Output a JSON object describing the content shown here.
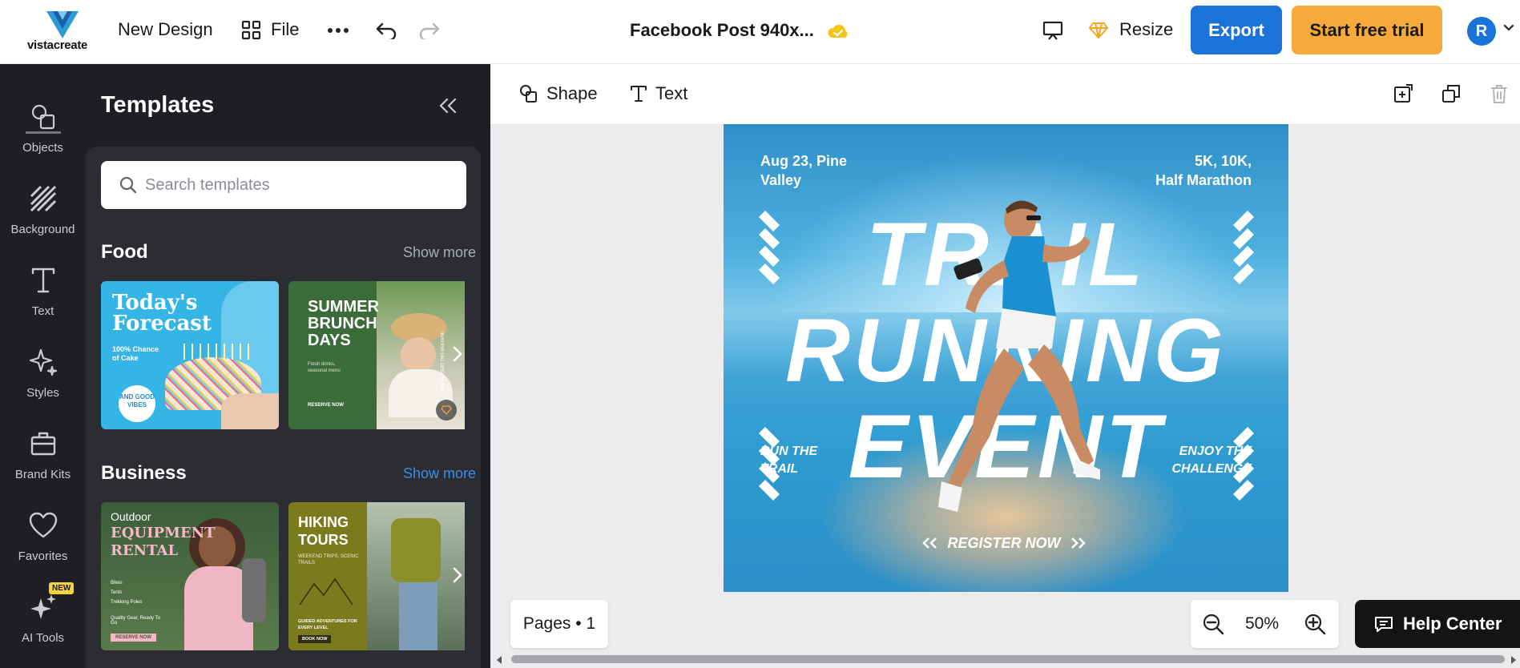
{
  "topbar": {
    "brand": "vistacreate",
    "new_design": "New Design",
    "file": "File",
    "doc_title": "Facebook Post 940x...",
    "resize": "Resize",
    "export": "Export",
    "start_trial": "Start free trial",
    "avatar_initial": "R"
  },
  "rail": {
    "items": [
      {
        "label": "Objects",
        "icon": "objects-icon"
      },
      {
        "label": "Background",
        "icon": "background-icon"
      },
      {
        "label": "Text",
        "icon": "text-icon"
      },
      {
        "label": "Styles",
        "icon": "styles-icon"
      },
      {
        "label": "Brand Kits",
        "icon": "brand-kits-icon"
      },
      {
        "label": "Favorites",
        "icon": "favorites-icon"
      },
      {
        "label": "AI Tools",
        "icon": "ai-tools-icon"
      }
    ],
    "new_badge": "NEW"
  },
  "panel": {
    "title": "Templates",
    "search_placeholder": "Search templates",
    "sections": [
      {
        "title": "Food",
        "show_more": "Show more",
        "cards": [
          {
            "title_line1": "Today's",
            "title_line2": "Forecast",
            "sub": "100% Chance of Cake",
            "badge": "AND GOOD VIBES"
          },
          {
            "title_line1": "SUMMER",
            "title_line2": "BRUNCH",
            "title_line3": "DAYS",
            "sub": "Fresh drinks, seasonal menu",
            "cta": "RESERVE NOW",
            "side": "FREE DESSERT THIS WEEKEND"
          }
        ]
      },
      {
        "title": "Business",
        "show_more": "Show more",
        "cards": [
          {
            "title_line1": "Outdoor",
            "title_line2": "EQUIPMENT",
            "title_line3": "RENTAL",
            "checks": [
              "Bikes",
              "Tents",
              "Trekking Poles"
            ],
            "sub": "Quality Gear, Ready To Go",
            "cta": "RESERVE NOW"
          },
          {
            "title_line1": "HIKING",
            "title_line2": "TOURS",
            "sub": "WEEKEND TRIPS, SCENIC TRAILS",
            "sub2": "GUIDED ADVENTURES FOR EVERY LEVEL",
            "cta": "BOOK NOW"
          }
        ]
      }
    ]
  },
  "context_bar": {
    "shape": "Shape",
    "text": "Text"
  },
  "poster": {
    "top_left": "Aug 23, Pine Valley",
    "top_left_l1": "Aug 23, Pine",
    "top_left_l2": "Valley",
    "top_right_l1": "5K, 10K,",
    "top_right_l2": "Half Marathon",
    "line1": "TRAIL",
    "line2": "RUNNING",
    "line3": "EVENT",
    "bottom_left_l1": "RUN THE",
    "bottom_left_l2": "TRAIL",
    "register": "REGISTER NOW",
    "bottom_right_l1": "ENJOY THE",
    "bottom_right_l2": "CHALLENGE"
  },
  "footer": {
    "pages": "Pages • 1",
    "zoom": "50%",
    "help": "Help Center"
  },
  "colors": {
    "accent_blue": "#1a73d9",
    "trial_orange": "#f7a93b",
    "sidebar_dark": "#1e1f24",
    "panel_dark": "#2c2d33",
    "link_blue": "#3a8ee6"
  }
}
